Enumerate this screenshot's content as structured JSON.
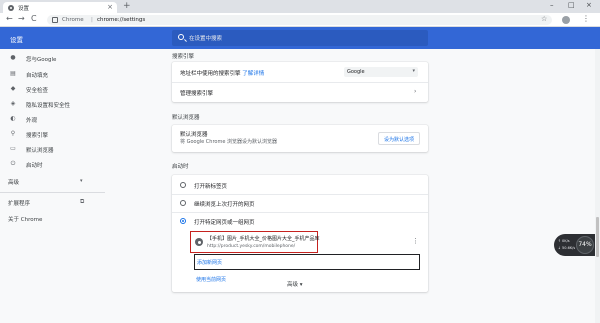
{
  "browser": {
    "tab_title": "设置",
    "tab_close": "×",
    "new_tab": "+",
    "window_controls": [
      "–",
      "□",
      "×"
    ],
    "site_label": "Chrome",
    "separator": "|",
    "url": "chrome://settings",
    "back": "←",
    "forward": "→",
    "reload": "C",
    "star": "☆",
    "menu": "⋮"
  },
  "header": {
    "title": "设置",
    "search_placeholder": "在设置中搜索"
  },
  "sidebar": {
    "items": [
      {
        "label": "您与Google",
        "icon": "person-icon"
      },
      {
        "label": "自动填充",
        "icon": "clipboard-icon"
      },
      {
        "label": "安全检查",
        "icon": "shield-icon"
      },
      {
        "label": "隐私设置和安全性",
        "icon": "shield-lock-icon"
      },
      {
        "label": "外观",
        "icon": "palette-icon"
      },
      {
        "label": "搜索引擎",
        "icon": "search-icon"
      },
      {
        "label": "默认浏览器",
        "icon": "browser-icon"
      },
      {
        "label": "启动时",
        "icon": "power-icon"
      }
    ],
    "advanced": "高级",
    "advanced_caret": "▾",
    "extensions": "扩展程序",
    "about": "关于 Chrome"
  },
  "search_engine": {
    "section": "搜索引擎",
    "row1_text": "地址栏中使用的搜索引擎",
    "row1_link": "了解详情",
    "selected": "Google",
    "row2_text": "管理搜索引擎"
  },
  "default_browser": {
    "section": "默认浏览器",
    "title": "默认浏览器",
    "desc": "将 Google Chrome 浏览器设为默认浏览器",
    "button": "设为默认选项"
  },
  "on_startup": {
    "section": "启动时",
    "options": [
      "打开新标签页",
      "继续浏览上次打开的网页",
      "打开特定网页或一组网页"
    ],
    "selected_index": 2,
    "page_title": "【手机】图片_手机大全_价格图片大全_手机产品库",
    "page_url": "http://product.yesky.com/mobilephone/",
    "add_page": "添加新网页",
    "use_current": "使用当前网页"
  },
  "footer": {
    "advanced": "高级 ▾"
  },
  "widget": {
    "percent": "74%",
    "up": "↑ 0K/s",
    "down": "↓ 50.6K/s"
  }
}
